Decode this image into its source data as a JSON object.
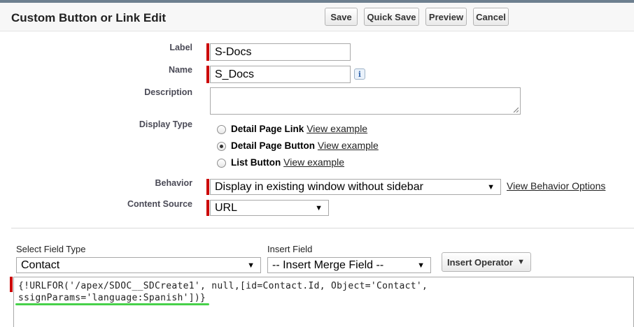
{
  "header": {
    "title": "Custom Button or Link Edit",
    "buttons": {
      "save": "Save",
      "quick_save": "Quick Save",
      "preview": "Preview",
      "cancel": "Cancel"
    }
  },
  "form": {
    "label": {
      "label": "Label",
      "value": "S-Docs"
    },
    "name": {
      "label": "Name",
      "value": "S_Docs",
      "info_icon": "i"
    },
    "description": {
      "label": "Description",
      "value": ""
    },
    "display_type": {
      "label": "Display Type",
      "options": [
        {
          "label": "Detail Page Link",
          "link": "View example",
          "selected": false
        },
        {
          "label": "Detail Page Button",
          "link": "View example",
          "selected": true
        },
        {
          "label": "List Button",
          "link": "View example",
          "selected": false
        }
      ]
    },
    "behavior": {
      "label": "Behavior",
      "value": "Display in existing window without sidebar",
      "options_link": "View Behavior Options"
    },
    "content_source": {
      "label": "Content Source",
      "value": "URL"
    }
  },
  "formula": {
    "select_field_type": {
      "label": "Select Field Type",
      "value": "Contact"
    },
    "insert_field": {
      "label": "Insert Field",
      "value": "-- Insert Merge Field --"
    },
    "insert_operator": "Insert Operator",
    "code_lines": [
      "{!URLFOR('/apex/SDOC__SDCreate1', null,[id=Contact.Id, Object='Contact',",
      "ssignParams='language:Spanish'])}"
    ]
  },
  "colors": {
    "required": "#cc0000",
    "highlight": "#47d14a",
    "header_bg": "#f7f7f7"
  }
}
